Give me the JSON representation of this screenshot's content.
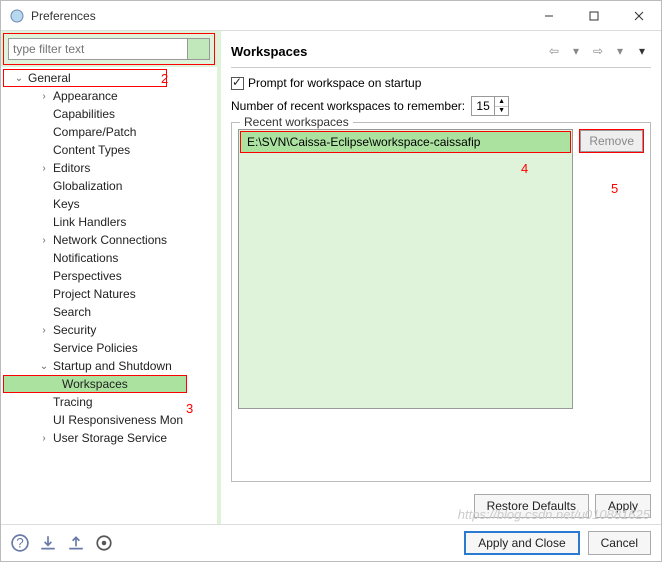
{
  "window": {
    "title": "Preferences"
  },
  "filter": {
    "placeholder": "type filter text"
  },
  "tree": {
    "general": "General",
    "items": [
      "Appearance",
      "Capabilities",
      "Compare/Patch",
      "Content Types",
      "Editors",
      "Globalization",
      "Keys",
      "Link Handlers",
      "Network Connections",
      "Notifications",
      "Perspectives",
      "Project Natures",
      "Search",
      "Security",
      "Service Policies",
      "Startup and Shutdown"
    ],
    "workspaces": "Workspaces",
    "rest": [
      "Tracing",
      "UI Responsiveness Mon",
      "User Storage Service"
    ]
  },
  "page": {
    "title": "Workspaces",
    "prompt": "Prompt for workspace on startup",
    "recent_label": "Number of recent workspaces to remember:",
    "recent_value": "15",
    "legend": "Recent workspaces",
    "recent_item": "E:\\SVN\\Caissa-Eclipse\\workspace-caissafip",
    "remove": "Remove",
    "restore": "Restore Defaults",
    "apply": "Apply"
  },
  "footer": {
    "apply_close": "Apply and Close",
    "cancel": "Cancel"
  },
  "annotations": {
    "a2": "2",
    "a3": "3",
    "a4": "4",
    "a5": "5"
  },
  "watermark": "https://blog.csdn.net/u010881625"
}
